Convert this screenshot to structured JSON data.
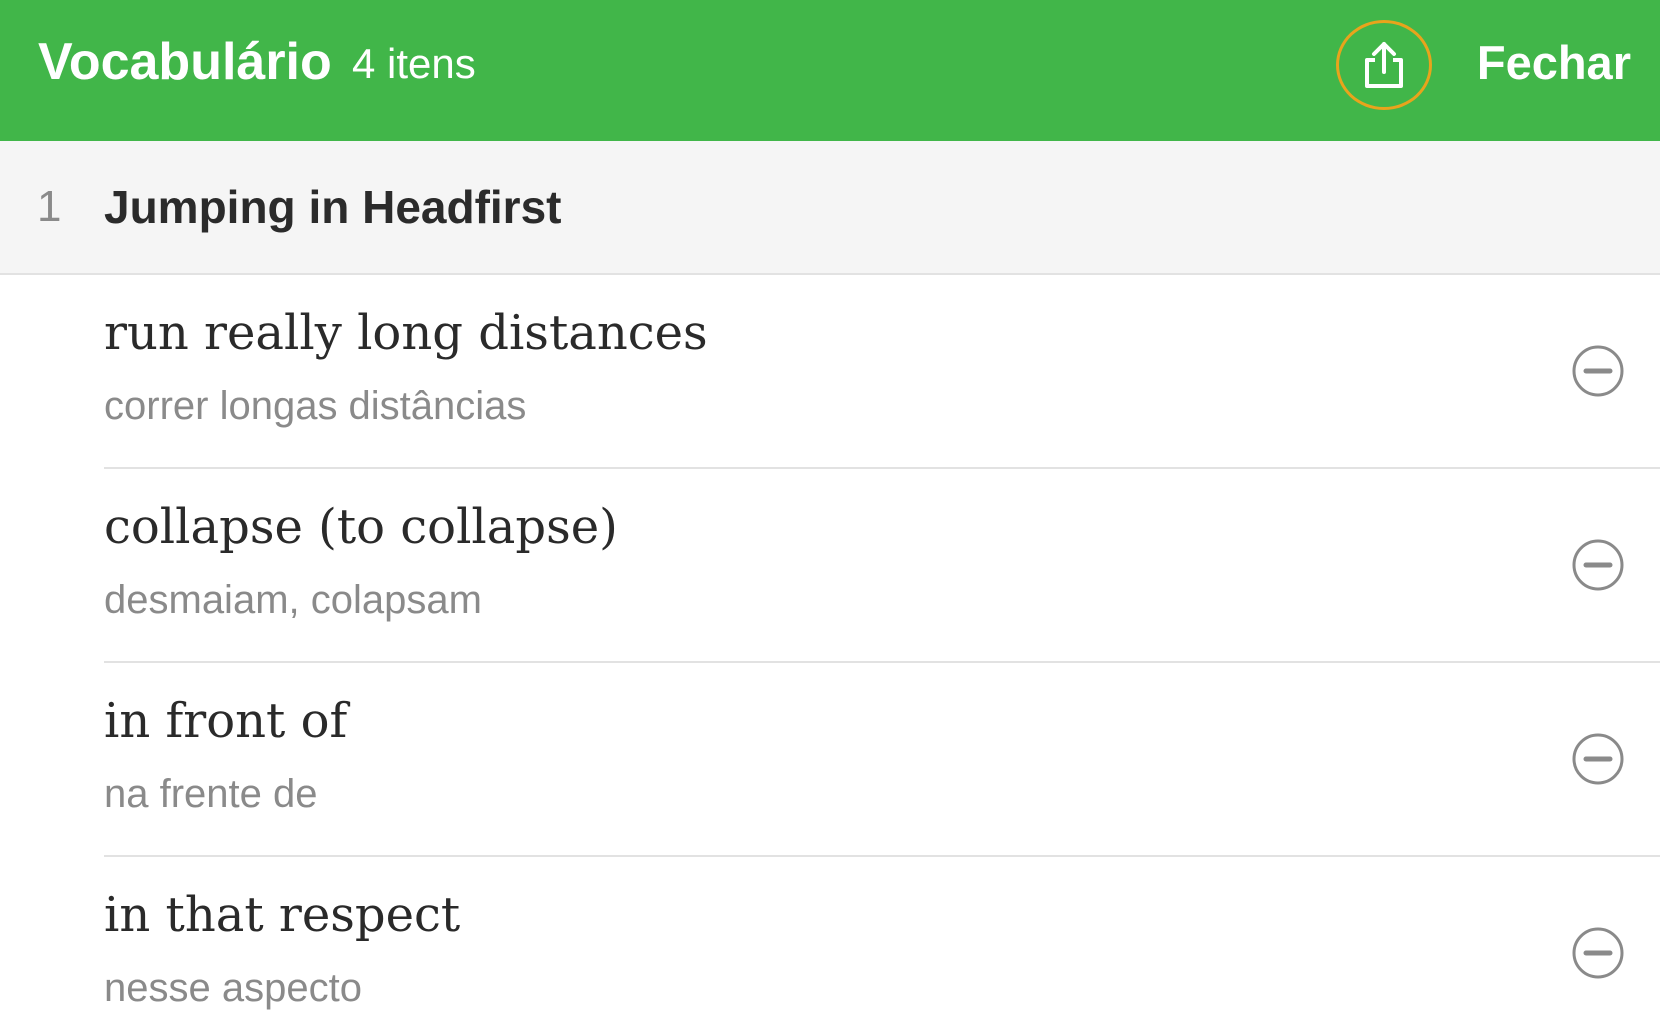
{
  "header": {
    "title": "Vocabulário",
    "count_label": "4 itens",
    "share_icon": "share-icon",
    "close_label": "Fechar",
    "background_color": "#41b649",
    "share_highlight_color": "#e8a41c"
  },
  "section": {
    "number": "1",
    "title": "Jumping in Headfirst"
  },
  "vocabulary": [
    {
      "term": "run really long distances",
      "translation": "correr longas distâncias",
      "remove_icon": "minus-circle-icon"
    },
    {
      "term": "collapse (to collapse)",
      "translation": "desmaiam, colapsam",
      "remove_icon": "minus-circle-icon"
    },
    {
      "term": "in front of",
      "translation": "na frente de",
      "remove_icon": "minus-circle-icon"
    },
    {
      "term": "in that respect",
      "translation": "nesse aspecto",
      "remove_icon": "minus-circle-icon"
    }
  ]
}
